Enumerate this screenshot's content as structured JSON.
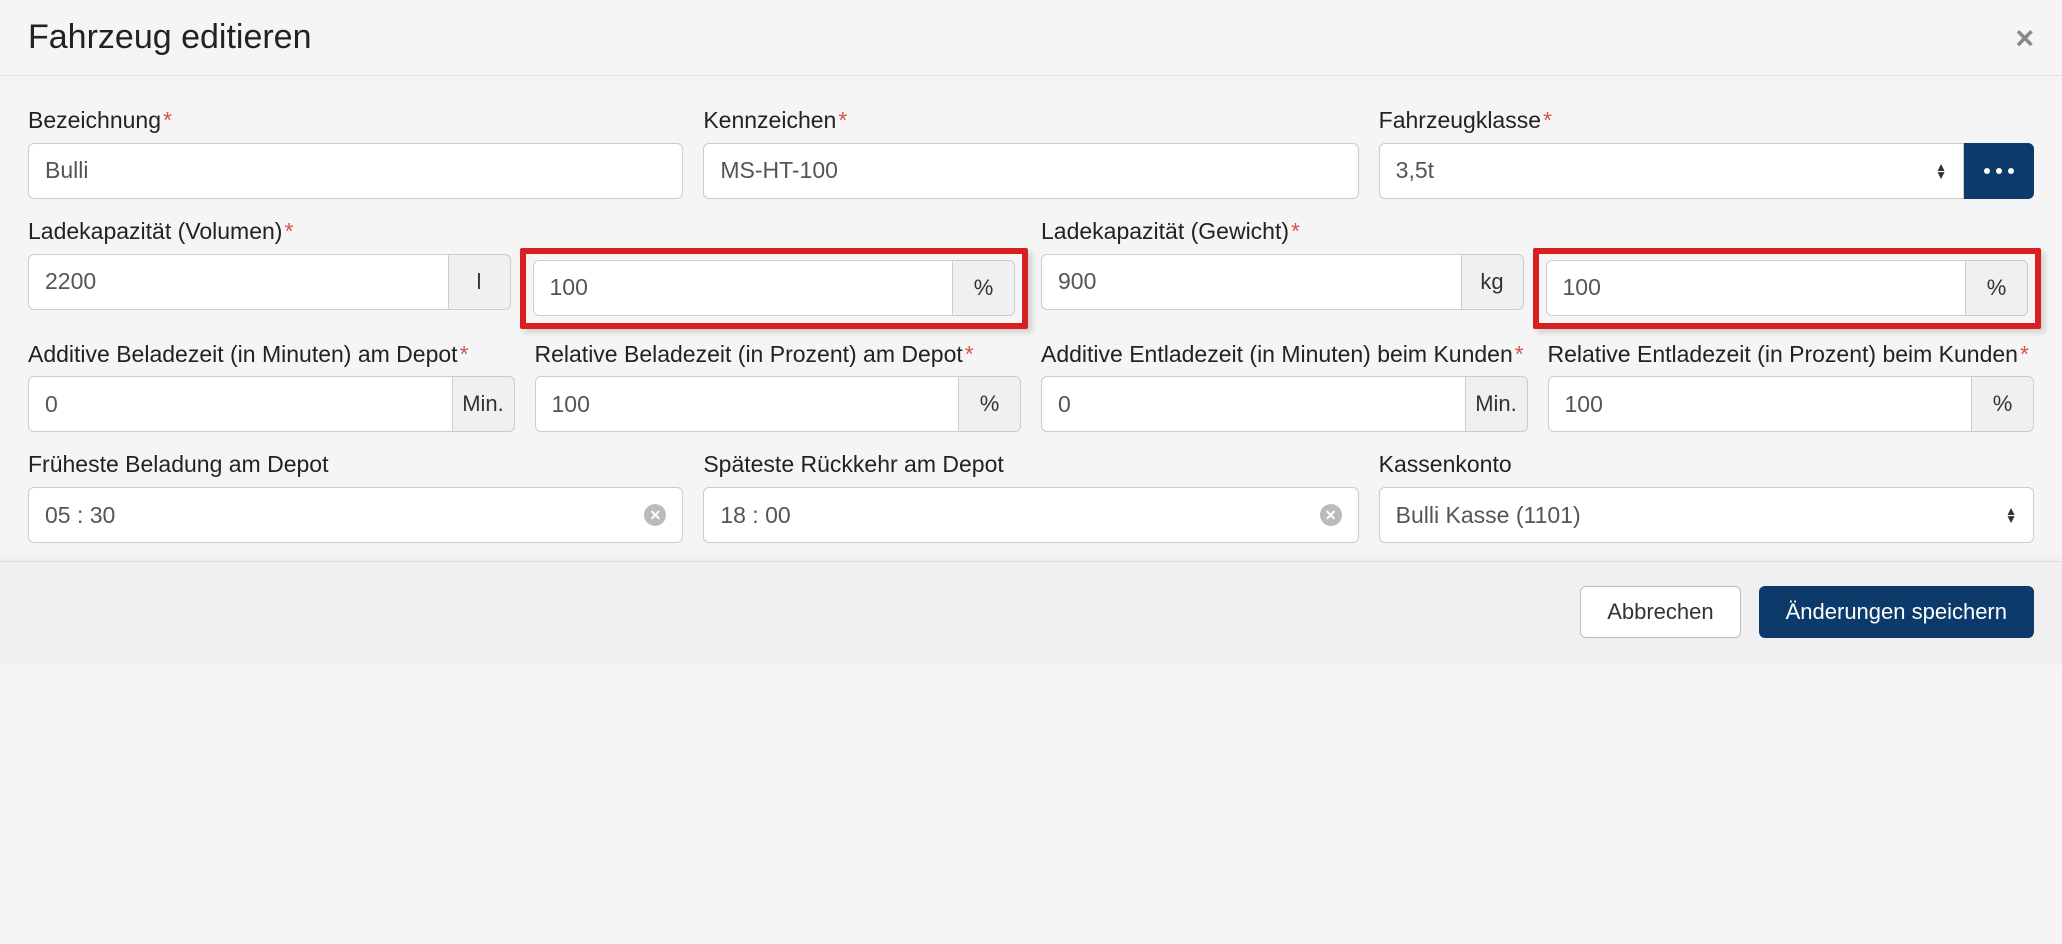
{
  "header": {
    "title": "Fahrzeug editieren"
  },
  "fields": {
    "bezeichnung": {
      "label": "Bezeichnung",
      "value": "Bulli"
    },
    "kennzeichen": {
      "label": "Kennzeichen",
      "value": "MS-HT-100"
    },
    "fahrzeugklasse": {
      "label": "Fahrzeugklasse",
      "value": "3,5t"
    },
    "ladekap_volumen": {
      "label": "Ladekapazität (Volumen)",
      "value": "2200",
      "unit": "l",
      "pct_value": "100",
      "pct_unit": "%"
    },
    "ladekap_gewicht": {
      "label": "Ladekapazität (Gewicht)",
      "value": "900",
      "unit": "kg",
      "pct_value": "100",
      "pct_unit": "%"
    },
    "add_beladezeit": {
      "label": "Additive Beladezeit (in Minuten) am Depot",
      "value": "0",
      "unit": "Min."
    },
    "rel_beladezeit": {
      "label": "Relative Beladezeit (in Prozent) am Depot",
      "value": "100",
      "unit": "%"
    },
    "add_entladezeit": {
      "label": "Additive Entladezeit (in Minuten) beim Kunden",
      "value": "0",
      "unit": "Min."
    },
    "rel_entladezeit": {
      "label": "Relative Entladezeit (in Prozent) beim Kunden",
      "value": "100",
      "unit": "%"
    },
    "frueheste_beladung": {
      "label": "Früheste Beladung am Depot",
      "value": "05 : 30"
    },
    "spaeteste_rueckkehr": {
      "label": "Späteste Rückkehr am Depot",
      "value": "18 : 00"
    },
    "kassenkonto": {
      "label": "Kassenkonto",
      "value": "Bulli Kasse (1101)"
    }
  },
  "footer": {
    "cancel": "Abbrechen",
    "save": "Änderungen speichern"
  }
}
